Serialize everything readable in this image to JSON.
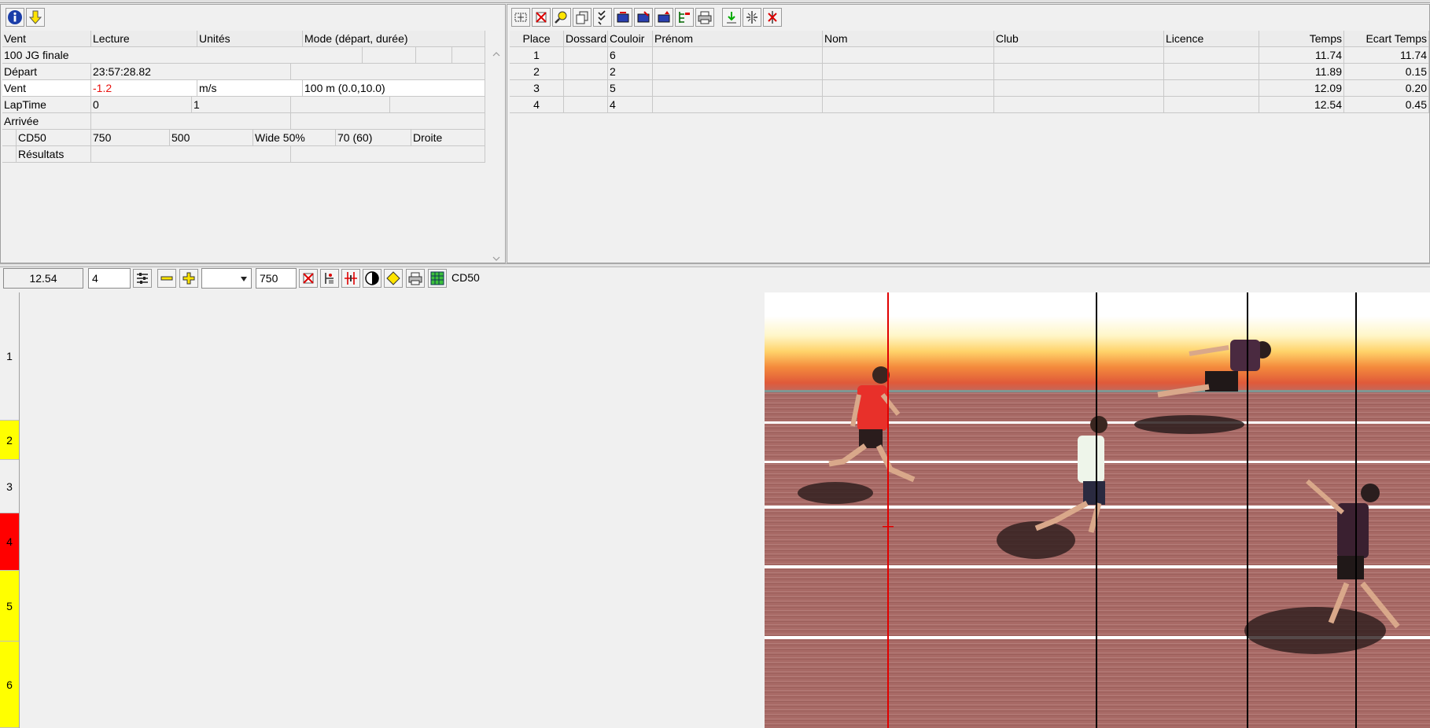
{
  "info_panel": {
    "grid_header": {
      "col1": "Vent",
      "col2": "Lecture",
      "col3": "Unités",
      "col4": "Mode (départ, durée)"
    },
    "race_name": "100 JG finale",
    "depart": {
      "label": "Départ",
      "value": "23:57:28.82"
    },
    "vent": {
      "label": "Vent",
      "reading": "-1.2",
      "unit": "m/s",
      "mode": "100 m (0.0,10.0)"
    },
    "laptime": {
      "label": "LapTime",
      "value1": "0",
      "value2": "1"
    },
    "arrivee": {
      "label": "Arrivée"
    },
    "camera": {
      "name": "CD50",
      "v1": "750",
      "v2": "500",
      "wide": "Wide 50%",
      "v3": "70  (60)",
      "side": "Droite"
    },
    "resultats": {
      "label": "Résultats"
    }
  },
  "results_table": {
    "headers": [
      "Place",
      "Dossard",
      "Couloir",
      "Prénom",
      "Nom",
      "Club",
      "Licence",
      "Temps",
      "Ecart Temps"
    ],
    "rows": [
      {
        "place": "1",
        "dossard": "",
        "couloir": "6",
        "prenom": "",
        "nom": "",
        "club": "",
        "licence": "",
        "temps": "11.74",
        "ecart": "11.74"
      },
      {
        "place": "2",
        "dossard": "",
        "couloir": "2",
        "prenom": "",
        "nom": "",
        "club": "",
        "licence": "",
        "temps": "11.89",
        "ecart": "0.15"
      },
      {
        "place": "3",
        "dossard": "",
        "couloir": "5",
        "prenom": "",
        "nom": "",
        "club": "",
        "licence": "",
        "temps": "12.09",
        "ecart": "0.20"
      },
      {
        "place": "4",
        "dossard": "",
        "couloir": "4",
        "prenom": "",
        "nom": "",
        "club": "",
        "licence": "",
        "temps": "12.54",
        "ecart": "0.45"
      }
    ]
  },
  "viewer_toolbar": {
    "time_value": "12.54",
    "lane_value": "4",
    "dropdown_value": "",
    "zoom_value": "750",
    "camera_label": "CD50"
  },
  "lanes": [
    {
      "label": "1",
      "color": "#f0f0f0"
    },
    {
      "label": "2",
      "color": "#ffff00"
    },
    {
      "label": "3",
      "color": "#f0f0f0"
    },
    {
      "label": "4",
      "color": "#ff0000"
    },
    {
      "label": "5",
      "color": "#ffff00"
    },
    {
      "label": "6",
      "color": "#ffff00"
    }
  ],
  "colors": {
    "vent_reading": "#e8120f",
    "cursor_line": "#e00000",
    "time_line": "#000000",
    "track": "#a86a66",
    "lane_line": "#ffffff"
  },
  "icons": {
    "info": "info-icon",
    "download": "download-arrow-icon",
    "results_toolbar": [
      "select-all-icon",
      "delete-icon",
      "search-icon",
      "copy-icon",
      "checklist-icon",
      "import-icon",
      "edit-list-icon",
      "export-icon",
      "tree-icon",
      "print-icon",
      "accept-icon",
      "split-icon",
      "cut-icon"
    ],
    "viewer_toolbar": [
      "settings-icon",
      "zoom-out-icon",
      "zoom-in-icon",
      "clear-icon",
      "measure-icon",
      "align-icon",
      "contrast-icon",
      "marker-icon",
      "print-icon",
      "grid-icon"
    ]
  }
}
